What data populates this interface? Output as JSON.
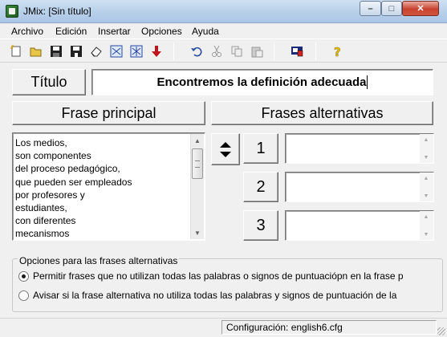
{
  "window": {
    "title": "JMix: [Sin título]",
    "controls": {
      "minimize": "–",
      "maximize": "□",
      "close": "✕"
    }
  },
  "menu": {
    "items": [
      "Archivo",
      "Edición",
      "Insertar",
      "Opciones",
      "Ayuda"
    ]
  },
  "toolbar": {
    "icons": [
      "new-file-icon",
      "open-folder-icon",
      "save-icon",
      "save-as-icon",
      "clear-icon",
      "export-icon",
      "export-alt-icon",
      "arrow-down-icon",
      "undo-icon",
      "cut-icon",
      "copy-icon",
      "paste-icon",
      "config-icon",
      "help-icon"
    ]
  },
  "title_section": {
    "button_label": "Título",
    "value": "Encontremos la definición adecuada"
  },
  "main_phrase": {
    "header": "Frase principal",
    "text": "Los medios,\nson componentes\ndel proceso pedagógico,\nque pueden ser empleados\npor profesores y\nestudiantes,\ncon diferentes\nmecanismos"
  },
  "alternatives": {
    "header": "Frases alternativas",
    "items": [
      {
        "number": "1",
        "value": ""
      },
      {
        "number": "2",
        "value": ""
      },
      {
        "number": "3",
        "value": ""
      }
    ]
  },
  "options": {
    "legend": "Opciones para las frases alternativas",
    "radio_1": "Permitir frases que no utilizan todas las palabras o signos de puntuaciópn en la frase p",
    "radio_2": "Avisar si la frase alternativa no utiliza todas las palabras y signos de puntuación de la",
    "selected": 1
  },
  "status": {
    "config": "Configuración: english6.cfg"
  },
  "colors": {
    "accent_titlebar": "#b9d1ea",
    "close_button": "#c7422f",
    "background": "#f0f0f0"
  }
}
